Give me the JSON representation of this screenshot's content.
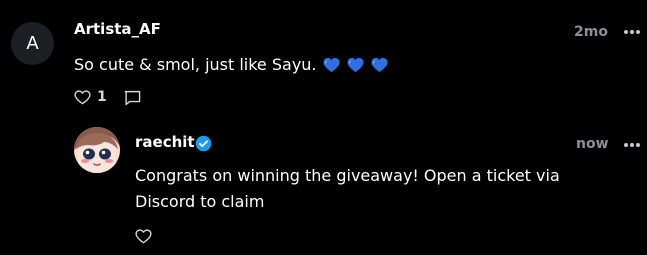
{
  "comments": [
    {
      "avatar_letter": "A",
      "username": "Artista_AF",
      "time": "2mo",
      "text": "So cute & smol, just like Sayu.",
      "emoji": [
        "blue-heart",
        "blue-heart",
        "blue-heart"
      ],
      "like_count": "1"
    },
    {
      "username": "raechit",
      "verified": true,
      "time": "now",
      "text_line1": "Congrats on winning the giveaway! Open a ticket via",
      "text_line2": "Discord to claim"
    }
  ],
  "colors": {
    "background": "#000000",
    "muted": "#8e8f96",
    "verified_badge": "#1d9bf0",
    "emoji_heart": "#2f6fe0"
  }
}
